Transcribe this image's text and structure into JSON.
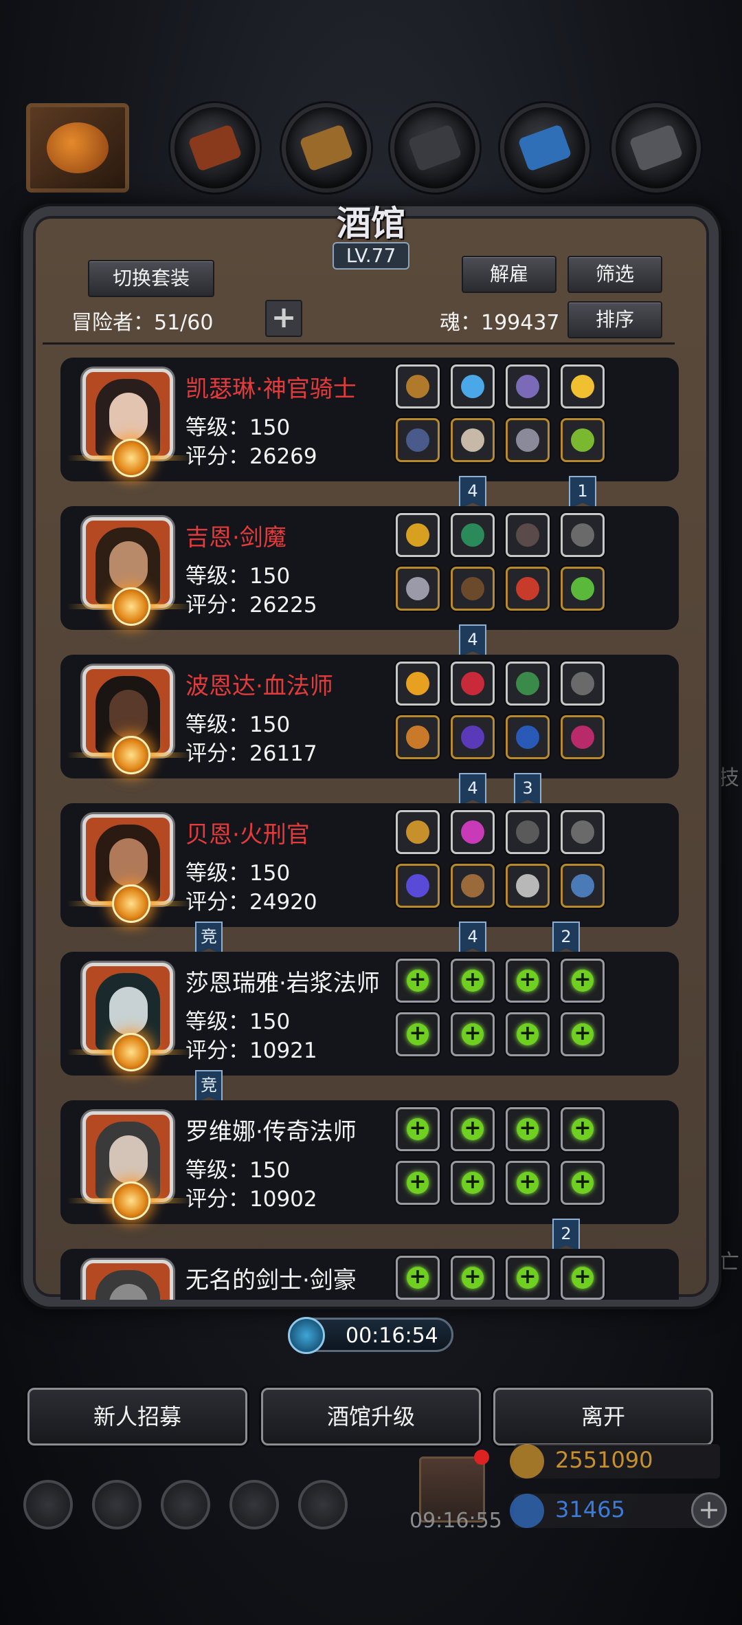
{
  "header": {
    "title": "酒馆",
    "level": "LV.77",
    "switch_outfit": "切换套装",
    "dismiss": "解雇",
    "filter": "筛选",
    "sort": "排序",
    "adventurers": "冒险者：51/60",
    "soul": "魂：199437",
    "add_symbol": "+"
  },
  "heroes": [
    {
      "name": "凯瑟琳·神官骑士",
      "name_color": "red",
      "level": "等级：150",
      "score": "评分：26269",
      "flags": [
        {
          "col": 1,
          "text": "4"
        },
        {
          "col": 3,
          "text": "1"
        }
      ],
      "empty": false
    },
    {
      "name": "吉恩·剑魔",
      "name_color": "red",
      "level": "等级：150",
      "score": "评分：26225",
      "flags": [
        {
          "col": 1,
          "text": "4"
        }
      ],
      "empty": false
    },
    {
      "name": "波恩达·血法师",
      "name_color": "red",
      "level": "等级：150",
      "score": "评分：26117",
      "flags": [
        {
          "col": 1,
          "text": "4"
        },
        {
          "col": 2,
          "text": "3"
        }
      ],
      "empty": false
    },
    {
      "name": "贝恩·火刑官",
      "name_color": "red",
      "level": "等级：150",
      "score": "评分：24920",
      "flags": [
        {
          "col": 1,
          "text": "4"
        },
        {
          "col": 2.7,
          "text": "2"
        }
      ],
      "comp": "竞",
      "empty": false
    },
    {
      "name": "莎恩瑞雅·岩浆法师",
      "name_color": "white",
      "level": "等级：150",
      "score": "评分：10921",
      "flags": [],
      "comp": "竞",
      "empty": true
    },
    {
      "name": "罗维娜·传奇法师",
      "name_color": "white",
      "level": "等级：150",
      "score": "评分：10902",
      "flags": [
        {
          "col": 2.7,
          "text": "2"
        }
      ],
      "empty": true
    },
    {
      "name": "无名的剑士·剑豪",
      "name_color": "white",
      "level": "",
      "score": "",
      "flags": [],
      "empty": true
    }
  ],
  "timer": "00:16:54",
  "buttons": {
    "recruit": "新人招募",
    "upgrade": "酒馆升级",
    "leave": "离开"
  },
  "background": {
    "clock": "09:16:55",
    "gold": "2551090",
    "gems": "31465",
    "side_glyph_1": "技",
    "side_glyph_2": "亡",
    "plus": "+"
  },
  "colors": {
    "name_red": "#e33b3b",
    "gold_text": "#c8902e",
    "gem_text": "#3d7bd6",
    "plus_green": "#6fd022"
  }
}
